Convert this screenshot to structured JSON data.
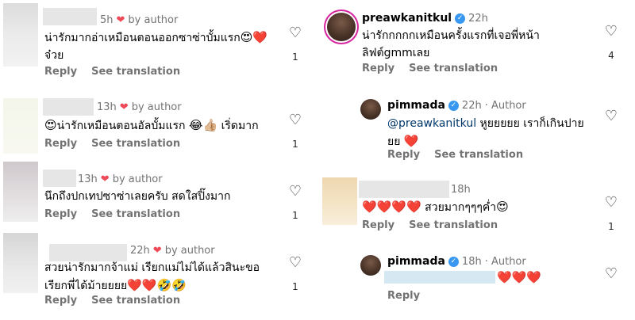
{
  "left": {
    "comments": [
      {
        "time": "5h",
        "author_label": "by author",
        "line1": "น่ารักมากอ่าเหมือนตอนออกซาซ่าบั้มแรก",
        "line1_emoji": "😍",
        "line1_heart": "❤️",
        "line2": "จ๋วย",
        "reply": "Reply",
        "translate": "See translation",
        "like_count": "1"
      },
      {
        "time": "13h",
        "author_label": "by author",
        "emoji_start": "😍",
        "line1": "น่ารักเหมือนตอนอัลบั้มแรก",
        "line1_emoji": "😂👍🏼",
        "line1_tail": "เริ่ดมาก",
        "reply": "Reply",
        "translate": "See translation",
        "like_count": "1"
      },
      {
        "time": "13h",
        "author_label": "by author",
        "line1": "นึกถึงปกเทปซาซ่าเลยครับ สดใสปิ๊งมาก",
        "reply": "Reply",
        "translate": "See translation",
        "like_count": "1"
      },
      {
        "time": "22h",
        "author_label": "by author",
        "line1": "สวยน่ารักมากจ้าแม่ เรียกแม่ไม่ได้แล้วสินะขอ",
        "line2": "เรียกพี่ได้ม้ายยยย",
        "line2_emoji": "❤️❤️🤣🤣",
        "reply": "Reply",
        "translate": "See translation",
        "like_count": "1"
      }
    ]
  },
  "right": {
    "comments": [
      {
        "username": "preawkanitkul",
        "time": "22h",
        "line1": "น่ารักกกกกเหมือนครั้งแรกที่เจอพี่หน้า",
        "line2": "ลิฟต์gmmเลย",
        "reply": "Reply",
        "translate": "See translation",
        "like_count": "4"
      },
      {
        "username": "pimmada",
        "time": "22h",
        "author_tag": "· Author",
        "mention": "@preawkanitkul",
        "line1": " หูยยยยย เราก็เกินปาย",
        "line2": "ยย",
        "line2_emoji": "❤️",
        "reply": "Reply",
        "translate": "See translation"
      },
      {
        "time": "18h",
        "line1_emoji": "❤️❤️❤️❤️",
        "line1": " สวยมากๆๆๆค่ำ",
        "line1_tail": "😍",
        "reply": "Reply",
        "translate": "See translation",
        "like_count": "1"
      },
      {
        "username": "pimmada",
        "time": "18h",
        "author_tag": "· Author",
        "line1_emoji": "❤️❤️❤️",
        "reply": "Reply"
      }
    ]
  },
  "colors": {
    "heart_red": "#ed4956",
    "meta_gray": "#737373",
    "mention_blue": "#00376b",
    "verified_blue": "#3897f0"
  },
  "icons": {
    "like": "heart-outline-icon",
    "author_like": "heart-filled-icon",
    "verified": "verified-badge-icon"
  }
}
